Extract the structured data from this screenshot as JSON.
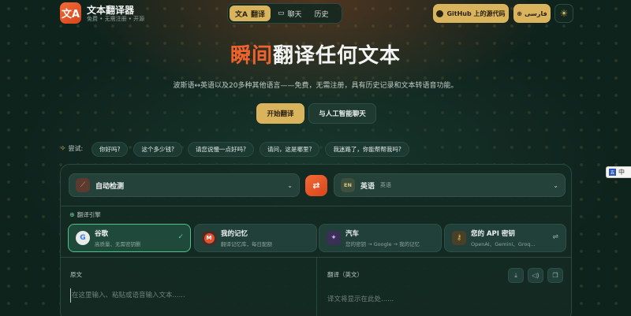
{
  "brand": {
    "logo_glyph": "文A",
    "title": "文本翻译器",
    "subtitle": "免费 • 无需注册 • 开源"
  },
  "nav": {
    "items": [
      {
        "icon": "文A",
        "label": "翻译",
        "active": true
      },
      {
        "icon": "▭",
        "label": "聊天",
        "active": false
      },
      {
        "icon": "",
        "label": "历史",
        "active": false
      }
    ]
  },
  "header": {
    "github_label": "GitHub 上的源代码",
    "lang_label": "فارسی",
    "lang_icon": "⊕",
    "theme_icon": "☀"
  },
  "hero": {
    "title_accent": "瞬间",
    "title_rest": "翻译任何文本",
    "subtitle": "波斯语↔英语以及20多种其他语言——免费，无需注册，具有历史记录和文本转语音功能。",
    "start_button": "开始翻译",
    "ai_chat_button": "与人工智能聊天"
  },
  "suggestions": {
    "label": "尝试:",
    "items": [
      "你好吗?",
      "这个多少钱?",
      "请您说慢一点好吗?",
      "请问，这是哪里?",
      "我迷路了，你能帮帮我吗?"
    ]
  },
  "translator": {
    "source_lang": {
      "icon": "⟋",
      "name": "自动检测"
    },
    "target_lang": {
      "code": "EN",
      "name": "英语",
      "native": "英语"
    },
    "swap_icon": "⇄",
    "engine_section_label": "翻译引擎",
    "engines": [
      {
        "icon": "G",
        "name": "谷歌",
        "desc": "高质量、无需密钥删",
        "selected": true
      },
      {
        "icon": "M",
        "name": "我的记忆",
        "desc": "翻译记忆库，每日配额",
        "selected": false
      },
      {
        "icon": "✦",
        "name": "汽车",
        "desc": "您的密钥 → Google → 我的记忆",
        "selected": false
      },
      {
        "icon": "⚷",
        "name": "您的 API 密钥",
        "desc": "OpenAI、Gemini、Groq...",
        "selected": false
      }
    ],
    "source_label": "原文",
    "source_placeholder": "在这里输入、粘贴或语音输入文本......",
    "target_label": "翻译（英文）",
    "target_placeholder": "译文将显示在此处......"
  },
  "side_widget": {
    "icon": "五",
    "text": "中"
  }
}
